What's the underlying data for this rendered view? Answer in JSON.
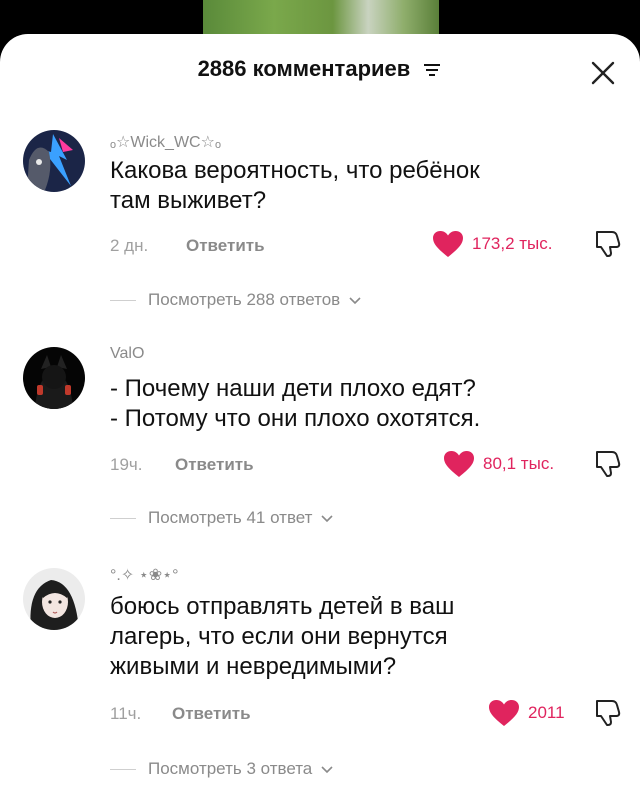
{
  "header": {
    "title": "2886 комментариев",
    "filter_icon": "filter-icon",
    "close_icon": "close-icon"
  },
  "reply_label": "Ответить",
  "comments": [
    {
      "username": "ₒ☆Wick_WC☆ₒ",
      "text_lines": [
        "Какова вероятность, что ребёнок",
        "там выживет?"
      ],
      "age": "2 дн.",
      "likes": "173,2 тыс.",
      "replies": "Посмотреть 288 ответов"
    },
    {
      "username": "ValO",
      "text_lines": [
        "- Почему наши дети плохо едят?",
        "- Потому что они плохо охотятся."
      ],
      "age": "19ч.",
      "likes": "80,1 тыс.",
      "replies": "Посмотреть 41 ответ"
    },
    {
      "username": "°.✧ ⋆❀⋆°",
      "text_lines": [
        "боюсь отправлять детей в ваш",
        "лагерь, что если они вернутся",
        "живыми и невредимыми?"
      ],
      "age": "11ч.",
      "likes": "2011",
      "replies": "Посмотреть 3 ответа"
    }
  ],
  "colors": {
    "like_red": "#e0245e",
    "meta_gray": "#8a8a8a"
  }
}
